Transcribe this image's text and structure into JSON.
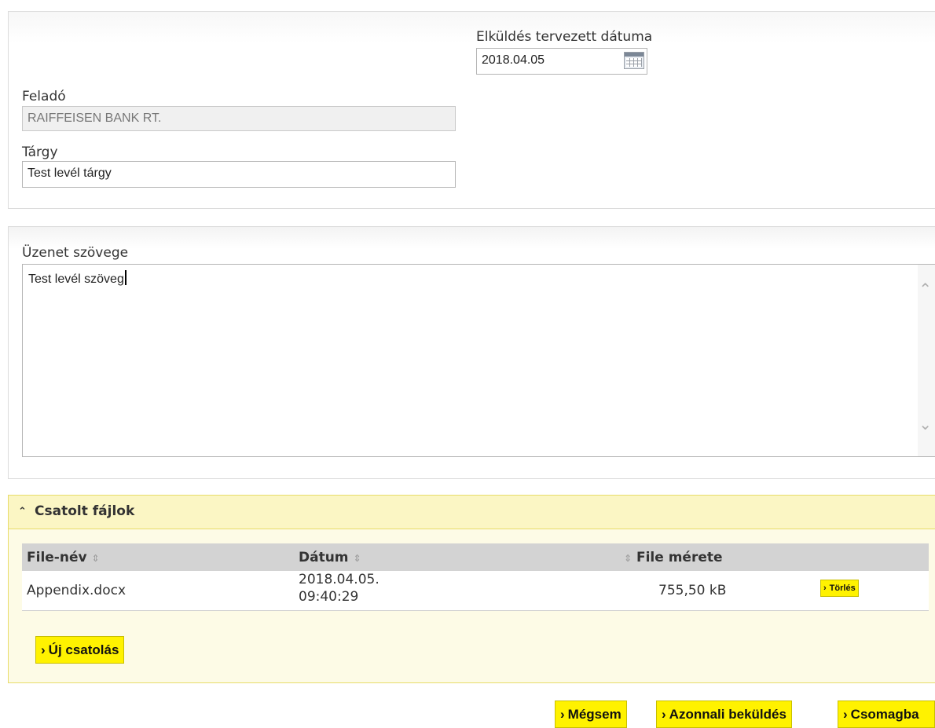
{
  "form": {
    "send_date_label": "Elküldés tervezett dátuma",
    "send_date_value": "2018.04.05",
    "sender_label": "Feladó",
    "sender_value": "RAIFFEISEN BANK RT.",
    "subject_label": "Tárgy",
    "subject_value": "Test levél tárgy",
    "message_label": "Üzenet szövege",
    "message_value": "Test levél szöveg"
  },
  "attachments": {
    "title": "Csatolt fájlok",
    "columns": {
      "name": "File-név",
      "date": "Dátum",
      "size": "File mérete"
    },
    "rows": [
      {
        "name": "Appendix.docx",
        "date_line1": "2018.04.05.",
        "date_line2": "09:40:29",
        "size": "755,50 kB",
        "delete_label": "Törlés"
      }
    ],
    "new_attachment_label": "Új csatolás"
  },
  "footer": {
    "cancel_label": "Mégsem",
    "send_now_label": "Azonnali beküldés",
    "package_label": "Csomagba"
  },
  "icons": {
    "calendar": "calendar-icon",
    "chevron": "chevron-up-icon",
    "sort": "sort-icon",
    "arrow": "chevron-right-icon"
  },
  "colors": {
    "button_yellow": "#fff200",
    "attach_bg": "#fdfbe6",
    "attach_header": "#fbf6c4",
    "table_header": "#d3d3d3"
  }
}
